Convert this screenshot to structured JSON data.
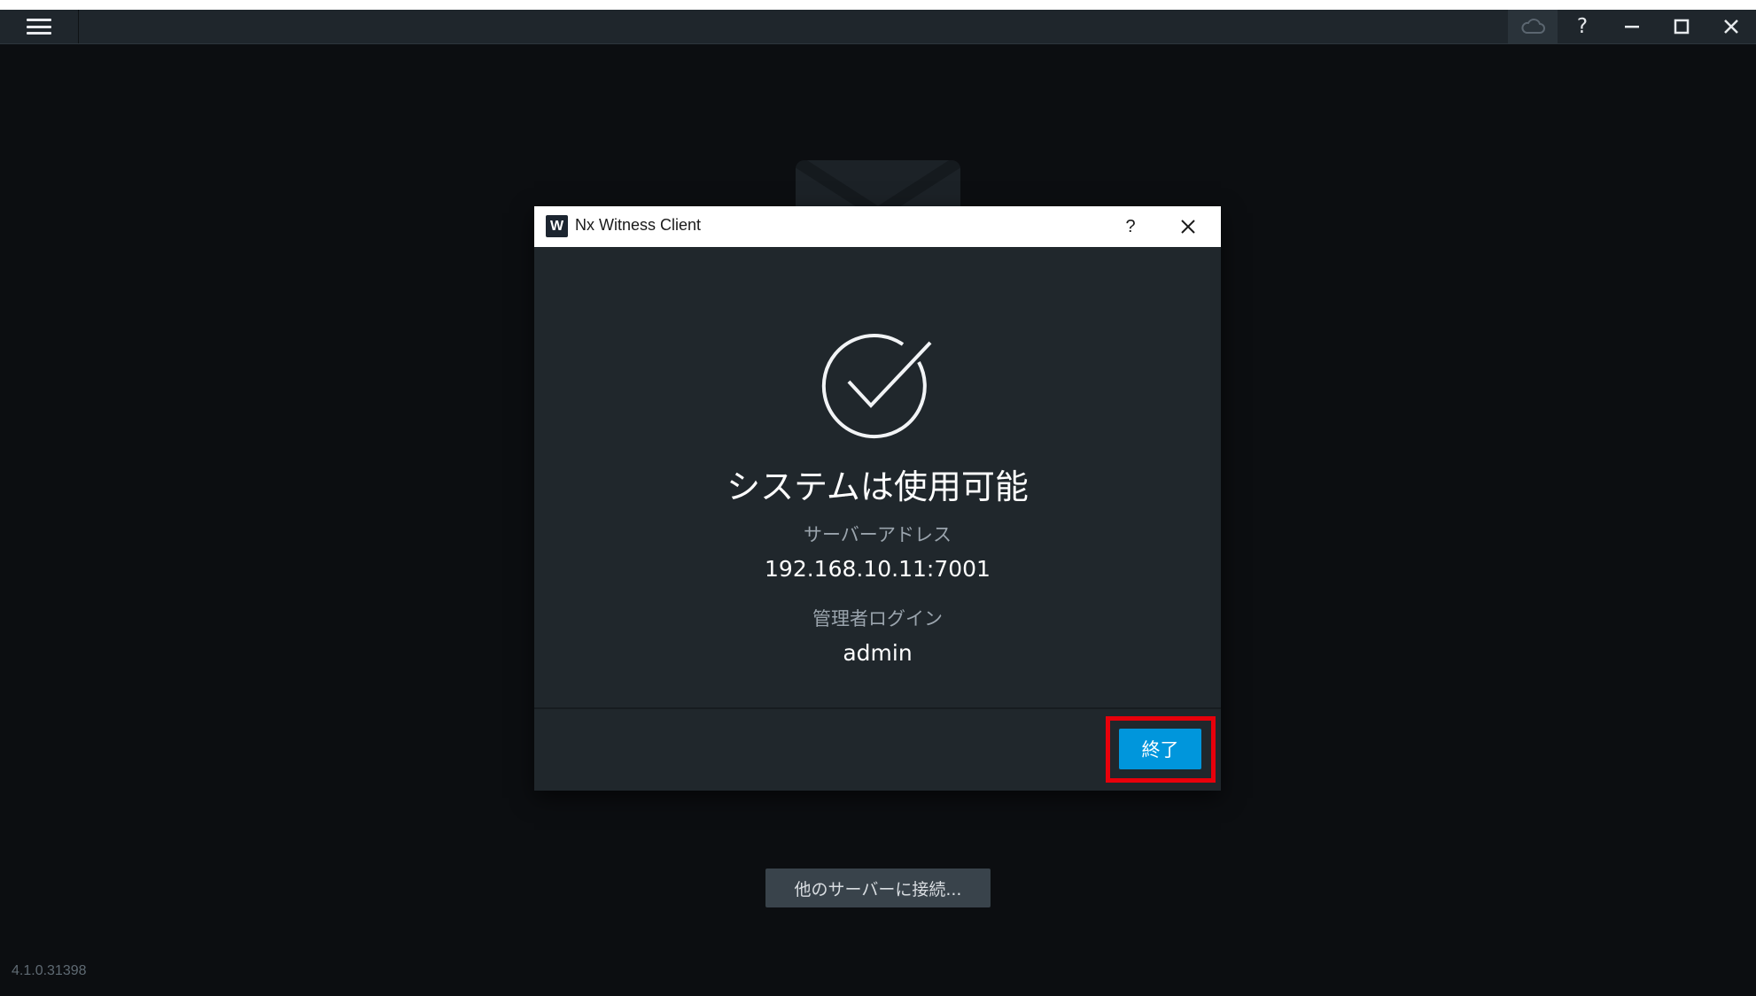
{
  "topbar": {
    "menu_icon": "hamburger-icon",
    "actions": [
      {
        "name": "cloud",
        "icon": "cloud-icon"
      },
      {
        "name": "help",
        "icon": "help-icon",
        "label": "?"
      },
      {
        "name": "minimize",
        "icon": "minimize-icon"
      },
      {
        "name": "maximize",
        "icon": "maximize-icon"
      },
      {
        "name": "close",
        "icon": "close-icon"
      }
    ]
  },
  "dialog": {
    "title": "Nx Witness Client",
    "logo_letter": "W",
    "help_label": "?",
    "heading": "システムは使用可能",
    "server_address_label": "サーバーアドレス",
    "server_address_value": "192.168.10.11:7001",
    "admin_login_label": "管理者ログイン",
    "admin_login_value": "admin",
    "finish_button": "終了"
  },
  "connect_other_button": "他のサーバーに接続...",
  "version": "4.1.0.31398",
  "colors": {
    "background": "#0c0e11",
    "dialog_bg": "#20272c",
    "accent_button": "#0096dc",
    "highlight_box": "#e8000b"
  }
}
